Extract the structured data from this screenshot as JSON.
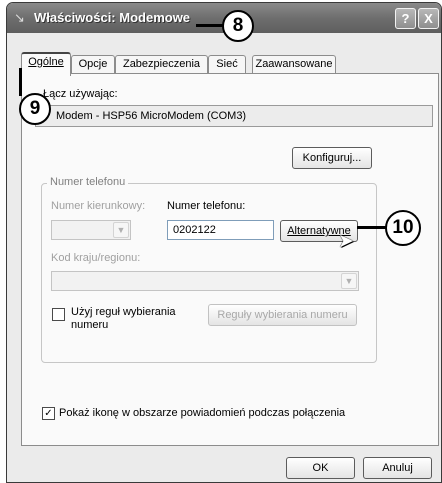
{
  "window": {
    "title": "Właściwości: Modemowe",
    "help_label": "?",
    "close_label": "X",
    "title_icon": "network-connection-icon"
  },
  "tabs": [
    {
      "label": "Ogólne",
      "active": true
    },
    {
      "label": "Opcje"
    },
    {
      "label": "Zabezpieczenia"
    },
    {
      "label": "Sieć"
    },
    {
      "label": "Zaawansowane"
    }
  ],
  "general": {
    "connect_using_label": "Łącz używając:",
    "device_name": "Modem - HSP56 MicroModem (COM3)",
    "configure_button": "Konfiguruj..."
  },
  "phone_group": {
    "title": "Numer telefonu",
    "area_code_label": "Numer kierunkowy:",
    "area_code_value": "",
    "phone_label": "Numer telefonu:",
    "phone_value": "0202122",
    "alternates_button": "Alternatywne",
    "country_label": "Kod kraju/regionu:",
    "country_value": "",
    "dialing_rules_label_line1": "Użyj reguł wybierania",
    "dialing_rules_label_line2": "numeru",
    "dialing_rules_checked": false,
    "dialing_rules_button": "Reguły wybierania numeru"
  },
  "show_icon": {
    "label": "Pokaż ikonę w obszarze powiadomień podczas połączenia",
    "checked": true,
    "check_glyph": "✓"
  },
  "footer": {
    "ok": "OK",
    "cancel": "Anuluj"
  },
  "callouts": {
    "c8": "8",
    "c9": "9",
    "c10": "10"
  },
  "colors": {
    "titlebar": "#6e6e6e",
    "dialog_bg": "#ebebeb",
    "page_bg": "#fafafa",
    "disabled_text": "#a0a0a0"
  }
}
